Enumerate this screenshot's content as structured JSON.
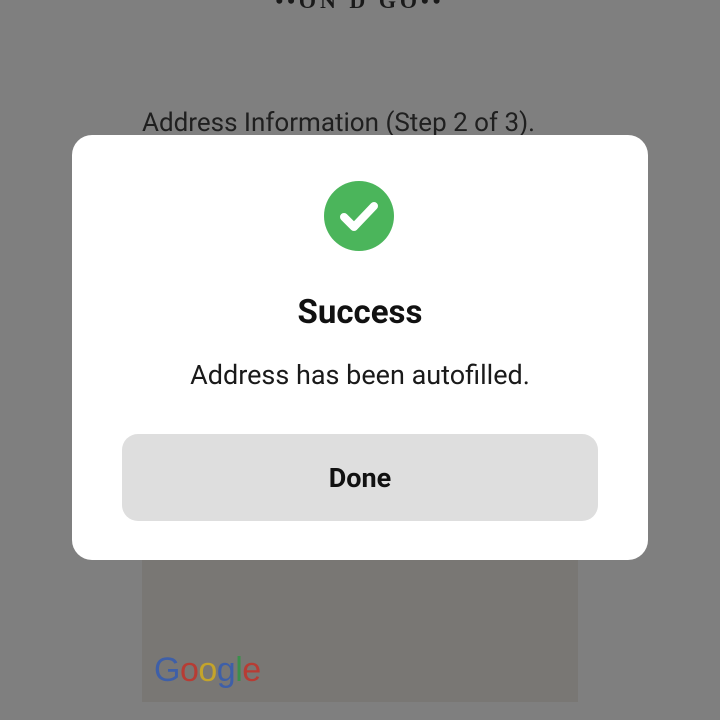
{
  "header": {
    "logo_text": "••ON  D  GO••"
  },
  "form": {
    "step_title": "Address Information (Step 2 of 3)."
  },
  "map": {
    "provider_logo": {
      "g1": "G",
      "o1": "o",
      "o2": "o",
      "g2": "g",
      "l": "l",
      "e": "e"
    }
  },
  "dialog": {
    "icon": "check-circle-icon",
    "title": "Success",
    "message": "Address has been autofilled.",
    "done_label": "Done",
    "accent_color": "#4bb55b"
  }
}
